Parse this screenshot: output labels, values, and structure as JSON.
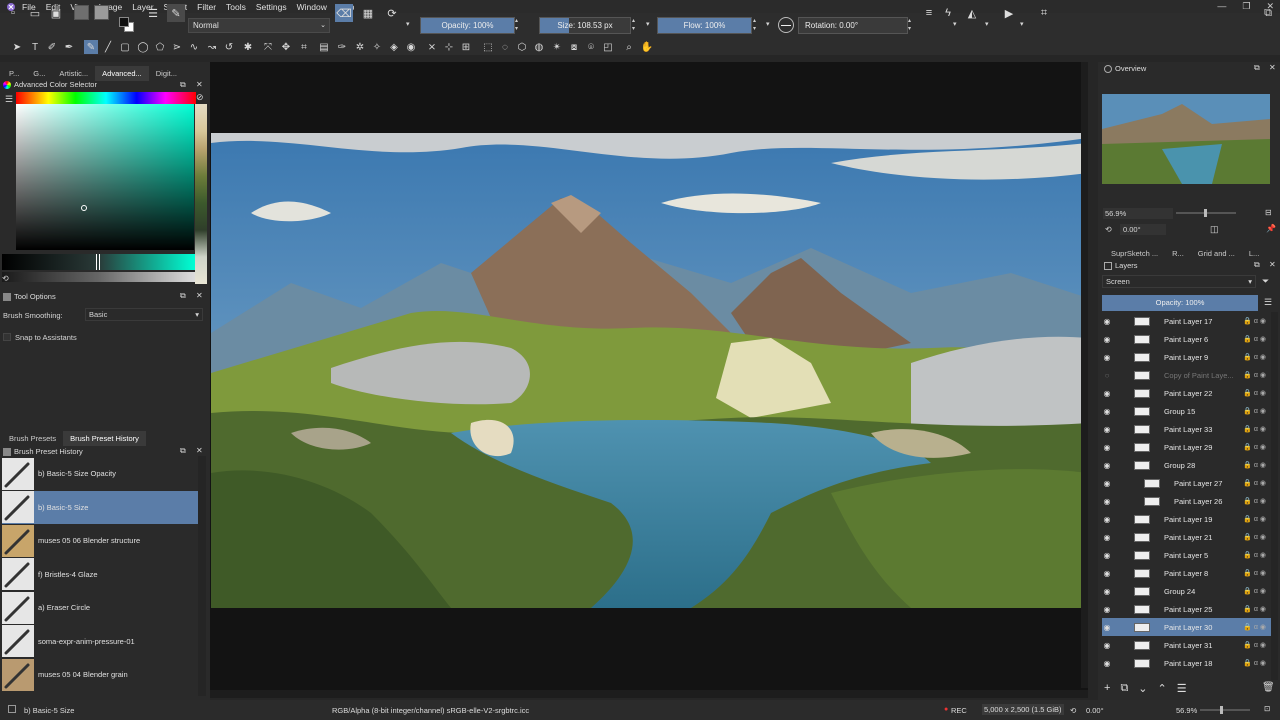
{
  "menubar": {
    "items": [
      "File",
      "Edit",
      "View",
      "Image",
      "Layer",
      "Select",
      "Filter",
      "Tools",
      "Settings",
      "Window",
      "Help"
    ]
  },
  "toolbar": {
    "blend_mode": "Normal",
    "opacity_label": "Opacity: 100%",
    "opacity_value": 1.0,
    "size_label": "Size: 108.53 px",
    "flow_label": "Flow: 100%",
    "flow_value": 1.0,
    "rotation_label": "Rotation: 0.00°"
  },
  "left_dock": {
    "top_tabs": [
      "P...",
      "G...",
      "Artistic...",
      "Advanced...",
      "Digit..."
    ],
    "color_selector_title": "Advanced Color Selector",
    "tool_options_title": "Tool Options",
    "brush_smoothing_label": "Brush Smoothing:",
    "brush_smoothing_value": "Basic",
    "snap_label": "Snap to Assistants",
    "bottom_tabs": [
      "Brush Presets",
      "Brush Preset History"
    ],
    "history_title": "Brush Preset History",
    "history_items": [
      {
        "name": "b) Basic-5 Size Opacity",
        "selected": false
      },
      {
        "name": "b) Basic-5 Size",
        "selected": true
      },
      {
        "name": "muses 05 06 Blender structure",
        "selected": false
      },
      {
        "name": "f) Bristles-4 Glaze",
        "selected": false
      },
      {
        "name": "a) Eraser Circle",
        "selected": false
      },
      {
        "name": "soma-expr-anim-pressure-01",
        "selected": false
      },
      {
        "name": "muses 05 04 Blender grain",
        "selected": false
      }
    ]
  },
  "right_dock": {
    "overview_title": "Overview",
    "zoom": "56.9%",
    "rotation": "0.00°",
    "tabs": [
      "SuprSketch ...",
      "R...",
      "Grid and ...",
      "L..."
    ],
    "layers_title": "Layers",
    "blend_mode": "Screen",
    "opacity_label": "Opacity:  100%",
    "layers": [
      {
        "name": "Paint Layer 17",
        "selected": false,
        "visible": true
      },
      {
        "name": "Paint Layer 6",
        "selected": false,
        "visible": true
      },
      {
        "name": "Paint Layer 9",
        "selected": false,
        "visible": true
      },
      {
        "name": "Copy of Paint Laye...",
        "selected": false,
        "visible": false
      },
      {
        "name": "Paint Layer 22",
        "selected": false,
        "visible": true
      },
      {
        "name": "Group 15",
        "selected": false,
        "visible": true
      },
      {
        "name": "Paint Layer 33",
        "selected": false,
        "visible": true
      },
      {
        "name": "Paint Layer 29",
        "selected": false,
        "visible": true
      },
      {
        "name": "Group 28",
        "selected": false,
        "visible": true
      },
      {
        "name": "Paint Layer 27",
        "selected": false,
        "visible": true
      },
      {
        "name": "Paint Layer 26",
        "selected": false,
        "visible": true
      },
      {
        "name": "Paint Layer 19",
        "selected": false,
        "visible": true
      },
      {
        "name": "Paint Layer 21",
        "selected": false,
        "visible": true
      },
      {
        "name": "Paint Layer 5",
        "selected": false,
        "visible": true
      },
      {
        "name": "Paint Layer 8",
        "selected": false,
        "visible": true
      },
      {
        "name": "Group 24",
        "selected": false,
        "visible": true
      },
      {
        "name": "Paint Layer 25",
        "selected": false,
        "visible": true
      },
      {
        "name": "Paint Layer 30",
        "selected": true,
        "visible": true
      },
      {
        "name": "Paint Layer 31",
        "selected": false,
        "visible": true
      },
      {
        "name": "Paint Layer 18",
        "selected": false,
        "visible": true
      }
    ]
  },
  "status": {
    "brush": "b) Basic-5 Size",
    "color_space": "RGB/Alpha (8-bit integer/channel)  sRGB-elle-V2-srgbtrc.icc",
    "rec": "REC",
    "dimensions": "5,000 x 2,500 (1.5 GiB)",
    "rotation": "0.00°",
    "zoom": "56.9%"
  },
  "colors": {
    "accent": "#5b7da8",
    "panel": "#2a2a2a",
    "canvas_bg": "#131313"
  }
}
